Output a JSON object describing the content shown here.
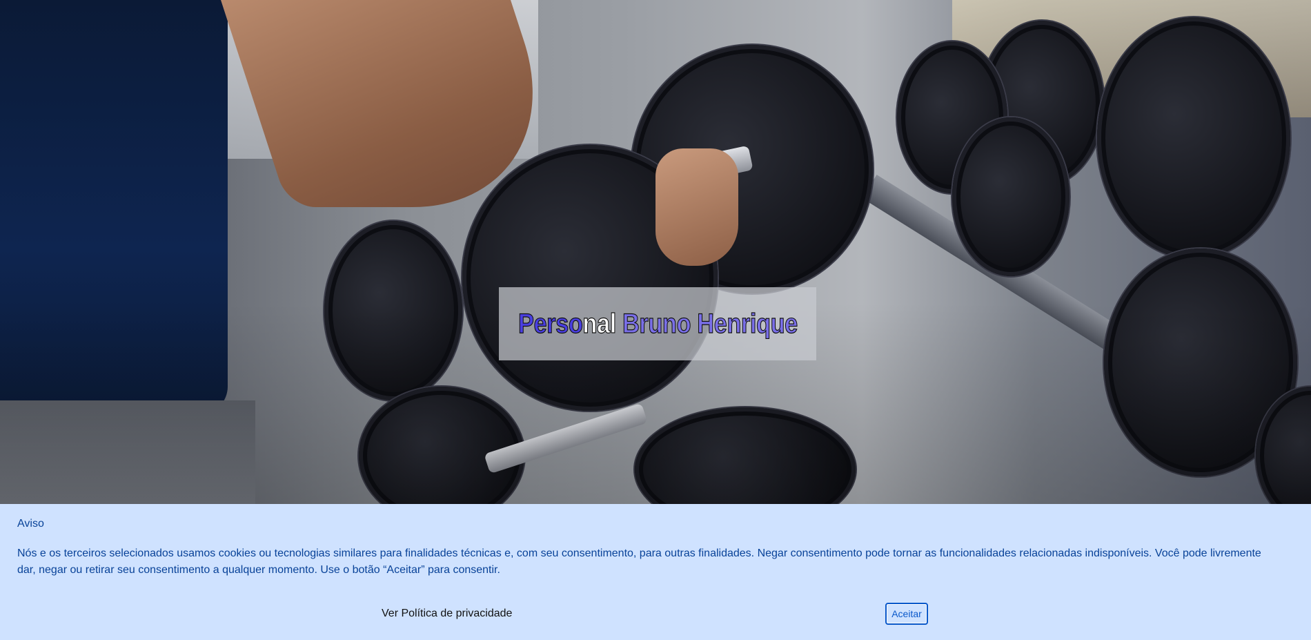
{
  "hero": {
    "image_description_icon": "gym-dumbbell-photo",
    "title_part1": "Perso",
    "title_part2": "nal ",
    "title_part3": "Bruno Henrique"
  },
  "cookie_banner": {
    "title": "Aviso",
    "text": "Nós e os terceiros selecionados usamos cookies ou tecnologias similares para finalidades técnicas e, com seu consentimento, para outras finalidades. Negar consentimento pode tornar as funcionalidades relacionadas indisponíveis. Você pode livremente dar, negar ou retirar seu consentimento a qualquer momento. Use o botão “Aceitar” para consentir.",
    "privacy_link": "Ver Política de privacidade",
    "accept_label": "Aceitar"
  },
  "colors": {
    "banner_bg": "#cfe2ff",
    "banner_text": "#084298",
    "title_blue": "#4a3fe0",
    "title_light": "#7a6fe8"
  }
}
